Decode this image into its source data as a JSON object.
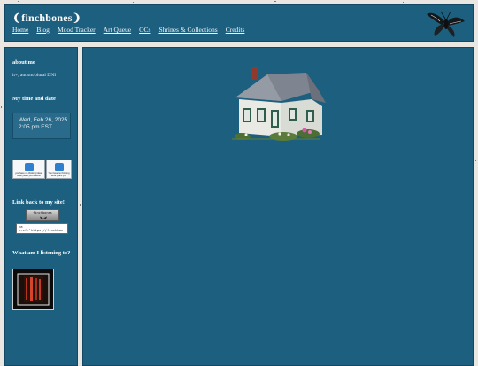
{
  "site": {
    "title": "❨finchbones❩"
  },
  "nav": {
    "items": [
      {
        "label": "Home"
      },
      {
        "label": "Blog"
      },
      {
        "label": "Mood Tracker"
      },
      {
        "label": "Art Queue"
      },
      {
        "label": "OCs"
      },
      {
        "label": "Shrines & Collections"
      },
      {
        "label": "Credits"
      }
    ]
  },
  "sidebar": {
    "about_title": "about me",
    "about_text": "it+, autism/plural DNI",
    "time_title": "My time and date",
    "clock_date": "Wed, Feb 26, 2025",
    "clock_time": "2:05 pm EST",
    "stamps": [
      {
        "text": "you have no thinking ideas  what years you against"
      },
      {
        "text": "You have no thinking  what years you"
      }
    ],
    "link_back_title": "Link back to my site!",
    "button_text": "finchbones",
    "code_text": "<a href=\"https://finchbon",
    "listening_title": "What am I listening to?"
  },
  "colors": {
    "panel": "#1d5f7f",
    "background": "#eae7e2",
    "link": "#eef6fb"
  },
  "icons": {
    "moth": "moth-icon",
    "house": "house-image"
  }
}
